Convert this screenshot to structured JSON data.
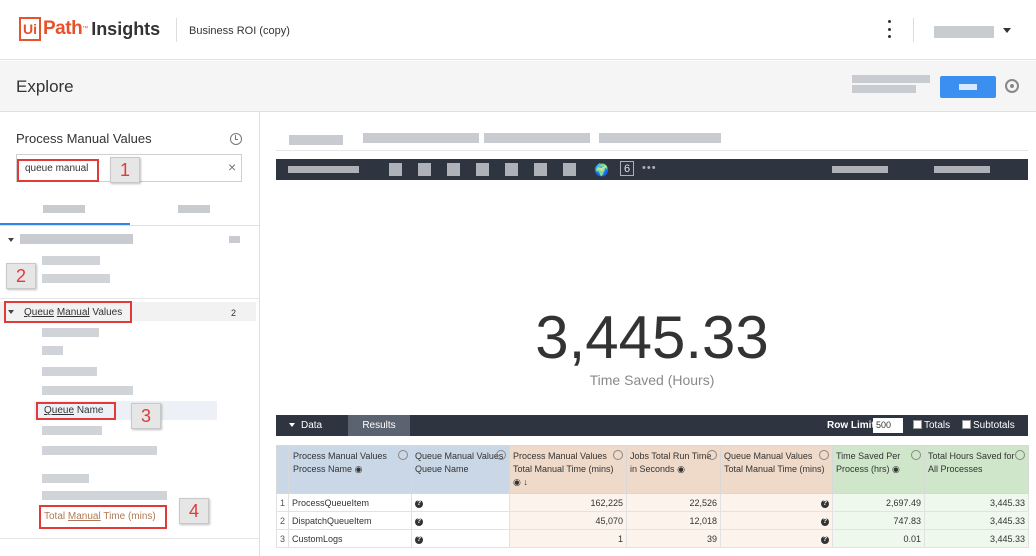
{
  "header": {
    "logo_box": "Ui",
    "logo_path": "Path",
    "logo_tm": "™",
    "logo_insights": "Insights",
    "title": "Business ROI (copy)"
  },
  "explore": {
    "title": "Explore"
  },
  "left": {
    "title": "Process Manual Values",
    "search_value": "queue manual",
    "group": {
      "label_part1": "Queue",
      "label_part2": "Manual",
      "label_part3": "Values",
      "count": "2"
    },
    "field_queue_name": {
      "part1": "Queue",
      "part2": "Name"
    },
    "field_total_manual": {
      "part1": "Total",
      "part2": "Manual",
      "part3": "Time (mins)"
    }
  },
  "annotations": [
    "1",
    "2",
    "3",
    "4"
  ],
  "viz": {
    "six_label": "6",
    "dots": "•••"
  },
  "single_value": {
    "value": "3,445.33",
    "label": "Time Saved (Hours)"
  },
  "data_bar": {
    "data_label": "Data",
    "results_label": "Results",
    "row_limit_label": "Row Limit",
    "row_limit_value": "500",
    "totals_label": "Totals",
    "subtotals_label": "Subtotals"
  },
  "table": {
    "columns": [
      "Process Manual Values Process Name",
      "Queue Manual Values Queue Name",
      "Process Manual Values Total Manual Time (mins)",
      "Jobs Total Run Time in Seconds",
      "Queue Manual Values Total Manual Time (mins)",
      "Time Saved Per Process (hrs)",
      "Total Hours Saved for All Processes"
    ],
    "rows": [
      {
        "n": "1",
        "process": "ProcessQueueItem",
        "queue": "?",
        "pm_time": "162,225",
        "jobs": "22,526",
        "qm_time": "?",
        "saved": "2,697.49",
        "total": "3,445.33"
      },
      {
        "n": "2",
        "process": "DispatchQueueItem",
        "queue": "?",
        "pm_time": "45,070",
        "jobs": "12,018",
        "qm_time": "?",
        "saved": "747.83",
        "total": "3,445.33"
      },
      {
        "n": "3",
        "process": "CustomLogs",
        "queue": "?",
        "pm_time": "1",
        "jobs": "39",
        "qm_time": "?",
        "saved": "0.01",
        "total": "3,445.33"
      }
    ]
  }
}
